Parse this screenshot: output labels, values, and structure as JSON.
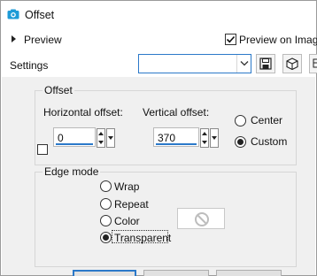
{
  "window": {
    "title": "Offset",
    "app_icon": "camera-icon",
    "accent_color": "#2b79c9"
  },
  "preview": {
    "label": "Preview",
    "preview_on_image_label": "Preview on Image",
    "preview_on_image_checked": true
  },
  "settings": {
    "label": "Settings",
    "combo_value": "",
    "save_icon": "save-icon",
    "cube_icon": "cube-icon"
  },
  "offset": {
    "group_title": "Offset",
    "horizontal_label": "Horizontal offset:",
    "horizontal_value": "0",
    "vertical_label": "Vertical offset:",
    "vertical_value": "370",
    "center_label": "Center",
    "custom_label": "Custom",
    "selected": "Custom"
  },
  "edge_mode": {
    "group_title": "Edge mode",
    "options": [
      "Wrap",
      "Repeat",
      "Color",
      "Transparent"
    ],
    "selected": "Transparent",
    "color_swatch_icon": "no-entry-icon"
  }
}
